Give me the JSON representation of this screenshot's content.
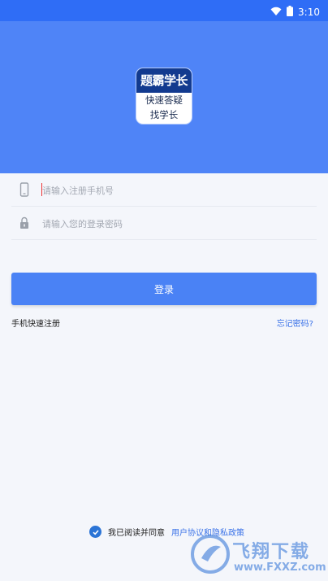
{
  "status": {
    "time": "3:10",
    "icons": [
      "wifi-icon",
      "battery-icon"
    ]
  },
  "logo": {
    "line1": "题霸学长",
    "line2": "快速答疑",
    "line3": "找学长"
  },
  "form": {
    "phone_placeholder": "请输入注册手机号",
    "password_placeholder": "请输入您的登录密码"
  },
  "login_label": "登录",
  "links": {
    "register": "手机快速注册",
    "forgot": "忘记密码?"
  },
  "agreement": {
    "text": "我已阅读并同意",
    "link": "用户协议和隐私政策"
  },
  "watermark": {
    "title": "飞翔下载",
    "sub": "www.FXXZ.com"
  },
  "colors": {
    "header": "#4f84f7",
    "button": "#4a82f5",
    "link": "#3a72e8"
  }
}
